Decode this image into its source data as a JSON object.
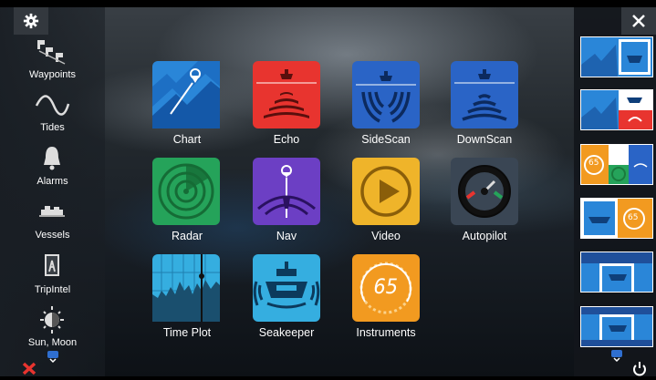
{
  "left_sidebar": {
    "items": [
      {
        "label": "Waypoints",
        "icon": "waypoints-icon"
      },
      {
        "label": "Tides",
        "icon": "tides-icon"
      },
      {
        "label": "Alarms",
        "icon": "alarm-bell-icon"
      },
      {
        "label": "Vessels",
        "icon": "vessels-icon"
      },
      {
        "label": "TripIntel",
        "icon": "tripintel-icon"
      },
      {
        "label": "Sun, Moon",
        "icon": "sun-moon-icon"
      }
    ]
  },
  "apps": [
    {
      "label": "Chart",
      "icon": "chart-icon",
      "color": "#2a86d8"
    },
    {
      "label": "Echo",
      "icon": "echo-icon",
      "color": "#e8342f"
    },
    {
      "label": "SideScan",
      "icon": "sidescan-icon",
      "color": "#2a64c6"
    },
    {
      "label": "DownScan",
      "icon": "downscan-icon",
      "color": "#2a64c6"
    },
    {
      "label": "Radar",
      "icon": "radar-icon",
      "color": "#25a35a"
    },
    {
      "label": "Nav",
      "icon": "nav-icon",
      "color": "#6c3fc4"
    },
    {
      "label": "Video",
      "icon": "video-icon",
      "color": "#efb42a"
    },
    {
      "label": "Autopilot",
      "icon": "autopilot-icon",
      "color": "#3a4654"
    },
    {
      "label": "Time Plot",
      "icon": "time-plot-icon",
      "color": "#35aee0"
    },
    {
      "label": "Seakeeper",
      "icon": "seakeeper-icon",
      "color": "#35aee0"
    },
    {
      "label": "Instruments",
      "icon": "instruments-icon",
      "color": "#f29a20"
    }
  ],
  "instruments_value": "65",
  "thumbnail_values": {
    "combo_3": "65",
    "combo_4": "65"
  },
  "corner_buttons": {
    "settings": "gear-icon",
    "close": "close-icon",
    "power": "power-icon",
    "dismiss_alarm": "red-x-icon"
  },
  "colors": {
    "accent_blue": "#2f6fd0",
    "alarm_red": "#e8342f"
  }
}
